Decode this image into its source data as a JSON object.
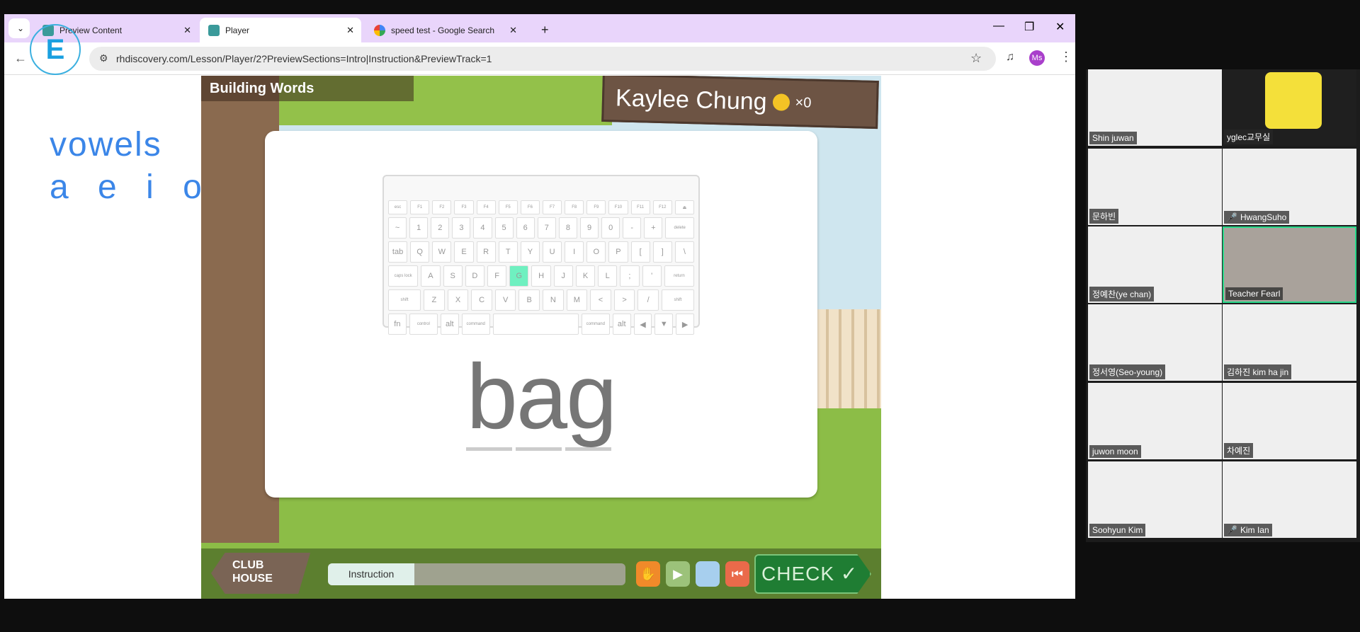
{
  "browser": {
    "tabs": [
      {
        "label": "Preview Content",
        "active": false
      },
      {
        "label": "Player",
        "active": true
      },
      {
        "label": "speed test - Google Search",
        "active": false
      }
    ],
    "new_tab": "+",
    "close": "✕",
    "url": "rhdiscovery.com/Lesson/Player/2?PreviewSections=Intro|Instruction&PreviewTrack=1",
    "profile": "Ms",
    "profile_color": "#a93fcb"
  },
  "notes": {
    "line1": "vowels",
    "line2": "a e i o u"
  },
  "game": {
    "title": "Building Words",
    "student": "Kaylee Chung",
    "coins": "×0",
    "keyboard": [
      [
        "esc",
        "F1",
        "F2",
        "F3",
        "F4",
        "F5",
        "F6",
        "F7",
        "F8",
        "F9",
        "F10",
        "F11",
        "F12",
        "⏏"
      ],
      [
        "~",
        "1",
        "2",
        "3",
        "4",
        "5",
        "6",
        "7",
        "8",
        "9",
        "0",
        "-",
        "+",
        "delete"
      ],
      [
        "tab",
        "Q",
        "W",
        "E",
        "R",
        "T",
        "Y",
        "U",
        "I",
        "O",
        "P",
        "[",
        "]",
        "\\"
      ],
      [
        "caps lock",
        "A",
        "S",
        "D",
        "F",
        "G",
        "H",
        "J",
        "K",
        "L",
        ";",
        "'",
        "return"
      ],
      [
        "shift",
        "Z",
        "X",
        "C",
        "V",
        "B",
        "N",
        "M",
        "<",
        ">",
        "/",
        "shift"
      ],
      [
        "fn",
        "control",
        "alt",
        "command",
        " ",
        "command",
        "alt",
        "◀",
        "▼",
        "▶"
      ]
    ],
    "highlighted_key": "G",
    "highlight_color": "#6ff0c0",
    "word": "bag",
    "club_house": [
      "CLUB",
      "HOUSE"
    ],
    "progress_label": "Instruction",
    "check": "CHECK ✓"
  },
  "participants": [
    {
      "name": "Shin juwan",
      "muted": false
    },
    {
      "name": "yglec교무실",
      "muted": false
    },
    {
      "name": "문하빈",
      "muted": false
    },
    {
      "name": "HwangSuho",
      "muted": true
    },
    {
      "name": "정예찬(ye chan)",
      "muted": false
    },
    {
      "name": "Teacher Fearl",
      "muted": false,
      "active_speaker": true
    },
    {
      "name": "정서영(Seo-young)",
      "muted": false
    },
    {
      "name": "김하진 kim ha jin",
      "muted": false
    },
    {
      "name": "juwon moon",
      "muted": false
    },
    {
      "name": "차예진",
      "muted": false
    },
    {
      "name": "Soohyun Kim",
      "muted": false
    },
    {
      "name": "Kim Ian",
      "muted": true
    }
  ]
}
